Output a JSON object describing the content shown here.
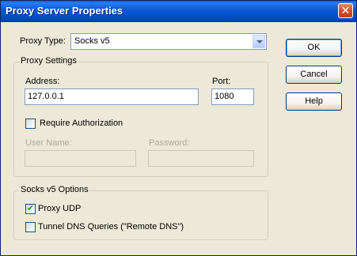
{
  "window": {
    "title": "Proxy Server Properties",
    "close_glyph": "✕"
  },
  "proxy_type": {
    "label": "Proxy Type:",
    "value": "Socks v5"
  },
  "proxy_settings": {
    "group_label": "Proxy Settings",
    "address_label": "Address:",
    "address_value": "127.0.0.1",
    "port_label": "Port:",
    "port_value": "1080",
    "require_auth_label": "Require Authorization",
    "require_auth_checked": false,
    "username_label": "User Name:",
    "username_value": "",
    "password_label": "Password:",
    "password_value": ""
  },
  "socks_options": {
    "group_label": "Socks v5 Options",
    "proxy_udp_label": "Proxy UDP",
    "proxy_udp_checked": true,
    "proxy_udp_mark": "✔",
    "tunnel_dns_label": "Tunnel DNS Queries (\"Remote DNS\")",
    "tunnel_dns_checked": false
  },
  "buttons": {
    "ok": "OK",
    "cancel": "Cancel",
    "help": "Help"
  }
}
